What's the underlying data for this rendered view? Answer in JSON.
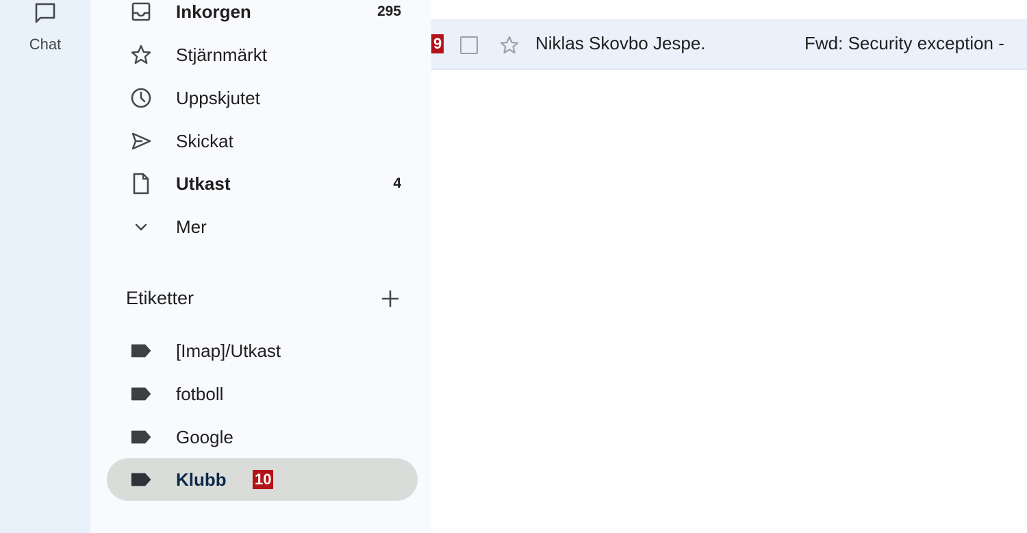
{
  "rail": {
    "chat_label": "Chat"
  },
  "nav": {
    "items": [
      {
        "label": "Inkorgen",
        "count": "295"
      },
      {
        "label": "Stjärnmärkt",
        "count": ""
      },
      {
        "label": "Uppskjutet",
        "count": ""
      },
      {
        "label": "Skickat",
        "count": ""
      },
      {
        "label": "Utkast",
        "count": "4"
      },
      {
        "label": "Mer",
        "count": ""
      }
    ],
    "labels_title": "Etiketter",
    "labels": [
      {
        "label": "[Imap]/Utkast"
      },
      {
        "label": "fotboll"
      },
      {
        "label": "Google"
      },
      {
        "label": "Klubb",
        "badge": "10"
      }
    ]
  },
  "mail_list": {
    "rows": [
      {
        "badge": "9",
        "sender": "Niklas Skovbo Jespe.",
        "subject": "Fwd: Security exception -"
      }
    ]
  },
  "colors": {
    "rail_bg": "#e9f1fb",
    "nav_bg": "#f8fafd",
    "selected_bg": "#d9dcd8",
    "row_bg": "#eaf1fb",
    "badge_bg": "#b3121a"
  }
}
